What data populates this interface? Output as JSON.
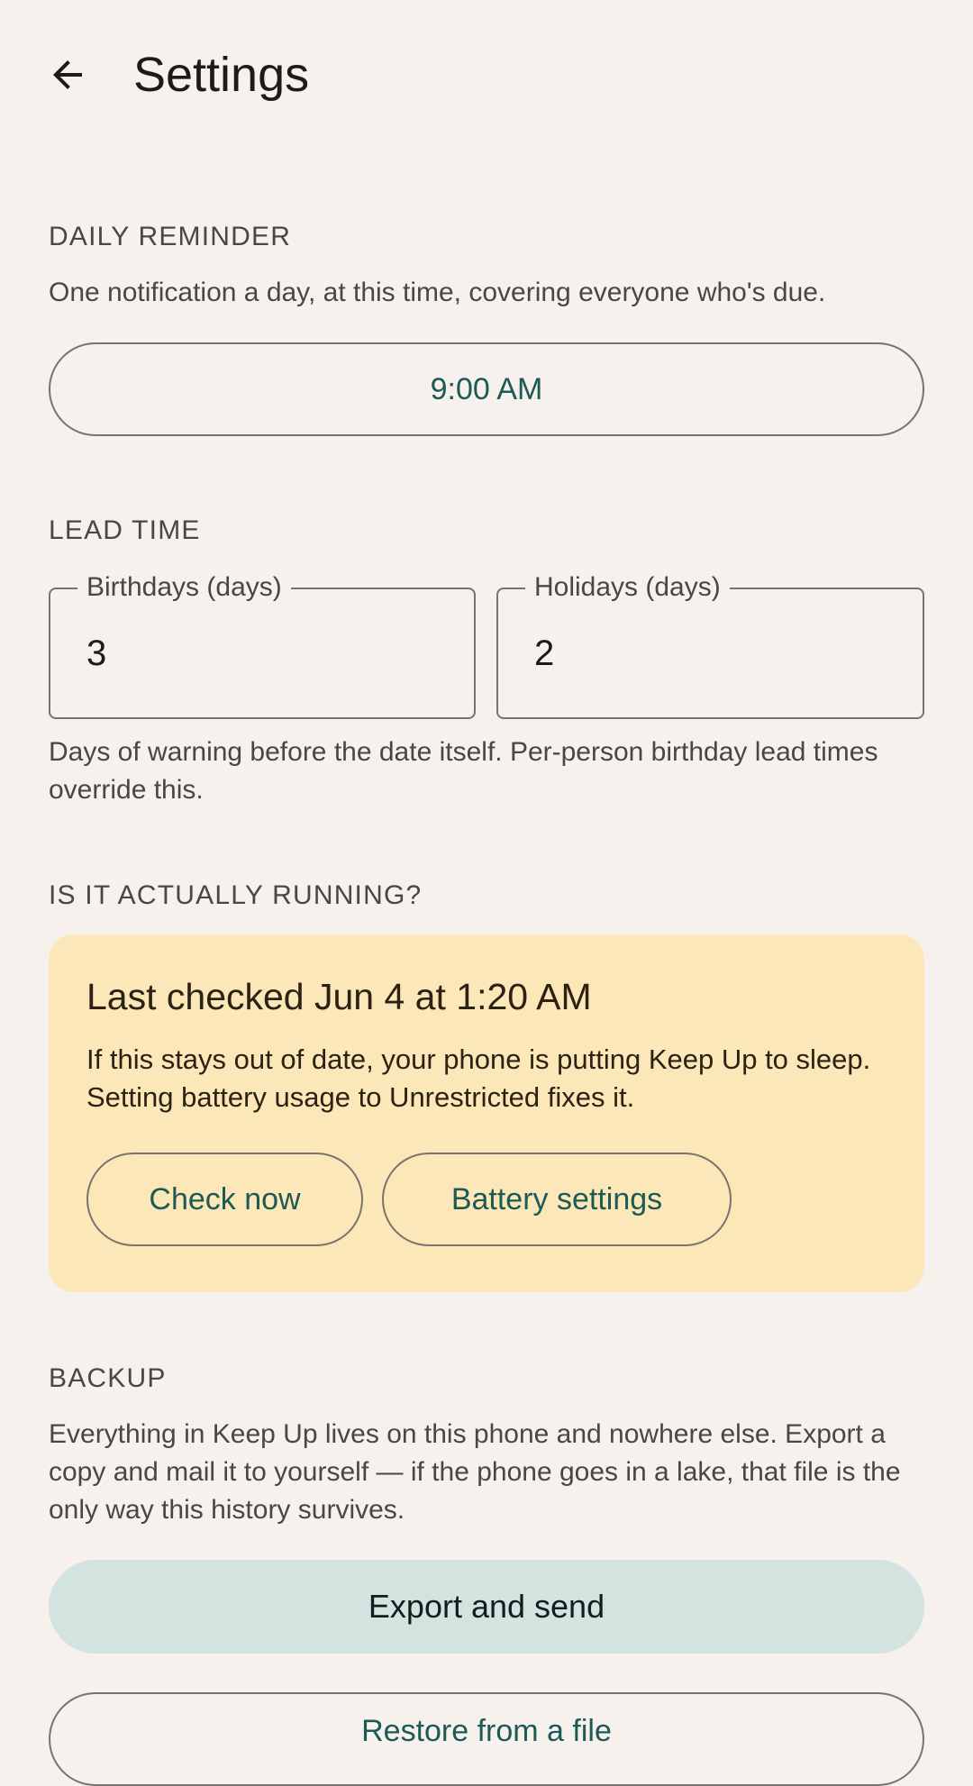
{
  "header": {
    "title": "Settings",
    "back_icon": "arrow-back-icon"
  },
  "daily_reminder": {
    "label": "DAILY REMINDER",
    "description": "One notification a day, at this time, covering everyone who's due.",
    "time_button": "9:00 AM"
  },
  "lead_time": {
    "label": "LEAD TIME",
    "birthdays_label": "Birthdays (days)",
    "birthdays_value": "3",
    "holidays_label": "Holidays (days)",
    "holidays_value": "2",
    "description": "Days of warning before the date itself. Per-person birthday lead times override this."
  },
  "running": {
    "label": "IS IT ACTUALLY RUNNING?",
    "card_title": "Last checked Jun 4 at 1:20 AM",
    "card_text": "If this stays out of date, your phone is putting Keep Up to sleep. Setting battery usage to Unrestricted fixes it.",
    "check_now": "Check now",
    "battery_settings": "Battery settings"
  },
  "backup": {
    "label": "BACKUP",
    "description": "Everything in Keep Up lives on this phone and nowhere else. Export a copy and mail it to yourself — if the phone goes in a lake, that file is the only way this history survives.",
    "export_button": "Export and send",
    "restore_button": "Restore from a file"
  },
  "colors": {
    "background": "#f6f1ec",
    "accent_text": "#1d5a55",
    "warning_card": "#fce7b8",
    "filled_button": "#d3e3e0"
  }
}
